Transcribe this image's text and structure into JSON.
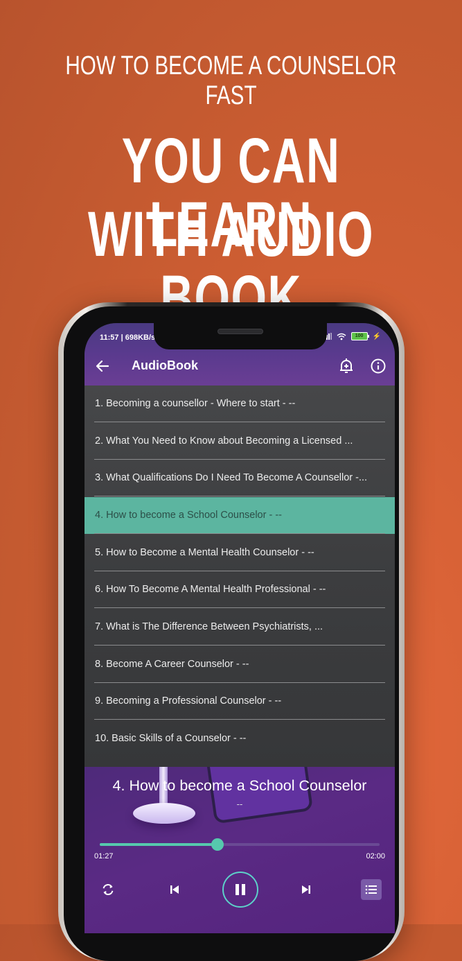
{
  "promo": {
    "subtitle": "HOW TO BECOME A COUNSELOR FAST",
    "headline_line1": "YOU CAN LEARN",
    "headline_line2": "WITH AUDIO BOOK"
  },
  "status_bar": {
    "time_and_speed": "11:57 | 698KB/s",
    "battery": "100",
    "icons": [
      "signal-icon",
      "wifi-icon",
      "battery-icon",
      "charging-icon"
    ]
  },
  "app_bar": {
    "title": "AudioBook",
    "icons": [
      "back-arrow-icon",
      "add-alarm-icon",
      "info-icon"
    ]
  },
  "chapters": [
    {
      "label": "1. Becoming a counsellor - Where to start - --",
      "active": false
    },
    {
      "label": "2. What You Need to Know about Becoming a Licensed ...",
      "active": false
    },
    {
      "label": "3. What Qualifications Do I Need To Become A Counsellor -...",
      "active": false
    },
    {
      "label": "4. How to become a School Counselor - --",
      "active": true
    },
    {
      "label": "5. How to Become a Mental Health Counselor - --",
      "active": false
    },
    {
      "label": "6. How To Become A Mental Health Professional - --",
      "active": false
    },
    {
      "label": "7. What is The Difference Between Psychiatrists, ...",
      "active": false
    },
    {
      "label": "8. Become A Career Counselor - --",
      "active": false
    },
    {
      "label": "9. Becoming a Professional Counselor - --",
      "active": false
    },
    {
      "label": "10. Basic Skills of a Counselor - --",
      "active": false
    }
  ],
  "player": {
    "now_playing_title": "4. How to become a School Counselor",
    "now_playing_subtitle": "--",
    "current_time": "01:27",
    "total_time": "02:00",
    "progress_fraction": 0.42,
    "state": "playing",
    "controls": [
      "repeat-icon",
      "previous-icon",
      "pause-icon",
      "next-icon",
      "playlist-icon"
    ]
  },
  "colors": {
    "accent": "#56c9ad",
    "app_bar": "#5a3a8e",
    "active_row": "#5cb5a0",
    "background": "#d25f34"
  }
}
